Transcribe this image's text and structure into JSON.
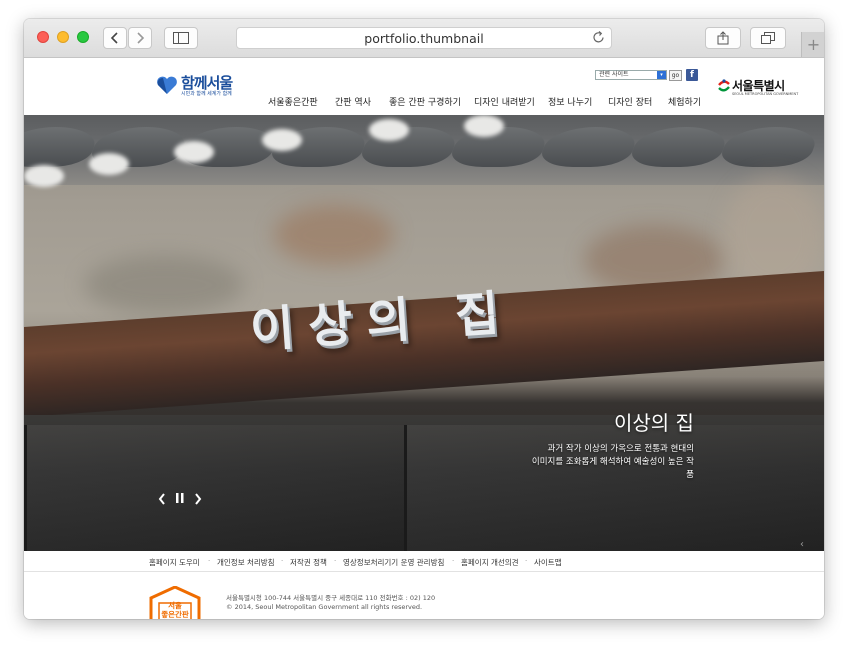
{
  "browser": {
    "url": "portfolio.thumbnail",
    "reload_icon": "reload-icon",
    "share_icon": "share-icon",
    "tabs_icon": "tabs-icon",
    "sidebar_icon": "sidebar-icon",
    "back_icon": "chevron-left-icon",
    "forward_icon": "chevron-right-icon",
    "new_tab_symbol": "+"
  },
  "header": {
    "logo_text": "함께서울",
    "logo_sub": "시민과 함께 세계가 함께",
    "related_select": "관련 사이트",
    "go_label": "go",
    "facebook_label": "f",
    "seoul_logo_text": "서울특별시",
    "seoul_logo_sub": "SEOUL METROPOLITAN GOVERNMENT",
    "nav": [
      "서울좋은간판",
      "간판 역사",
      "좋은 간판 구경하기",
      "디자인 내려받기",
      "정보 나누기",
      "디자인 장터",
      "체험하기"
    ]
  },
  "hero": {
    "sign_text": "이상의 집",
    "title": "이상의 집",
    "desc_line1": "과거 작가 이상의 가옥으로 전통과 현대의",
    "desc_line2": "이미지를 조화롭게 해석하여 예술성이 높은 작품",
    "prev": "‹",
    "pause": "❚❚",
    "next": "›",
    "corner": "‹"
  },
  "footer": {
    "links": [
      "홈페이지 도우미",
      "개인정보 처리방침",
      "저작권 정책",
      "영상정보처리기기 운영 관리방침",
      "홈페이지 개선의견",
      "사이트맵"
    ],
    "separator": "·",
    "seal_line1": "서울",
    "seal_line2": "좋은간판",
    "address": "서울특별시청 100-744 서울특별시 중구 세종대로 110    전화번호 : 02) 120",
    "copyright": "© 2014, Seoul Metropolitan Government all rights reserved.",
    "accent_color": "#ef6c00"
  }
}
